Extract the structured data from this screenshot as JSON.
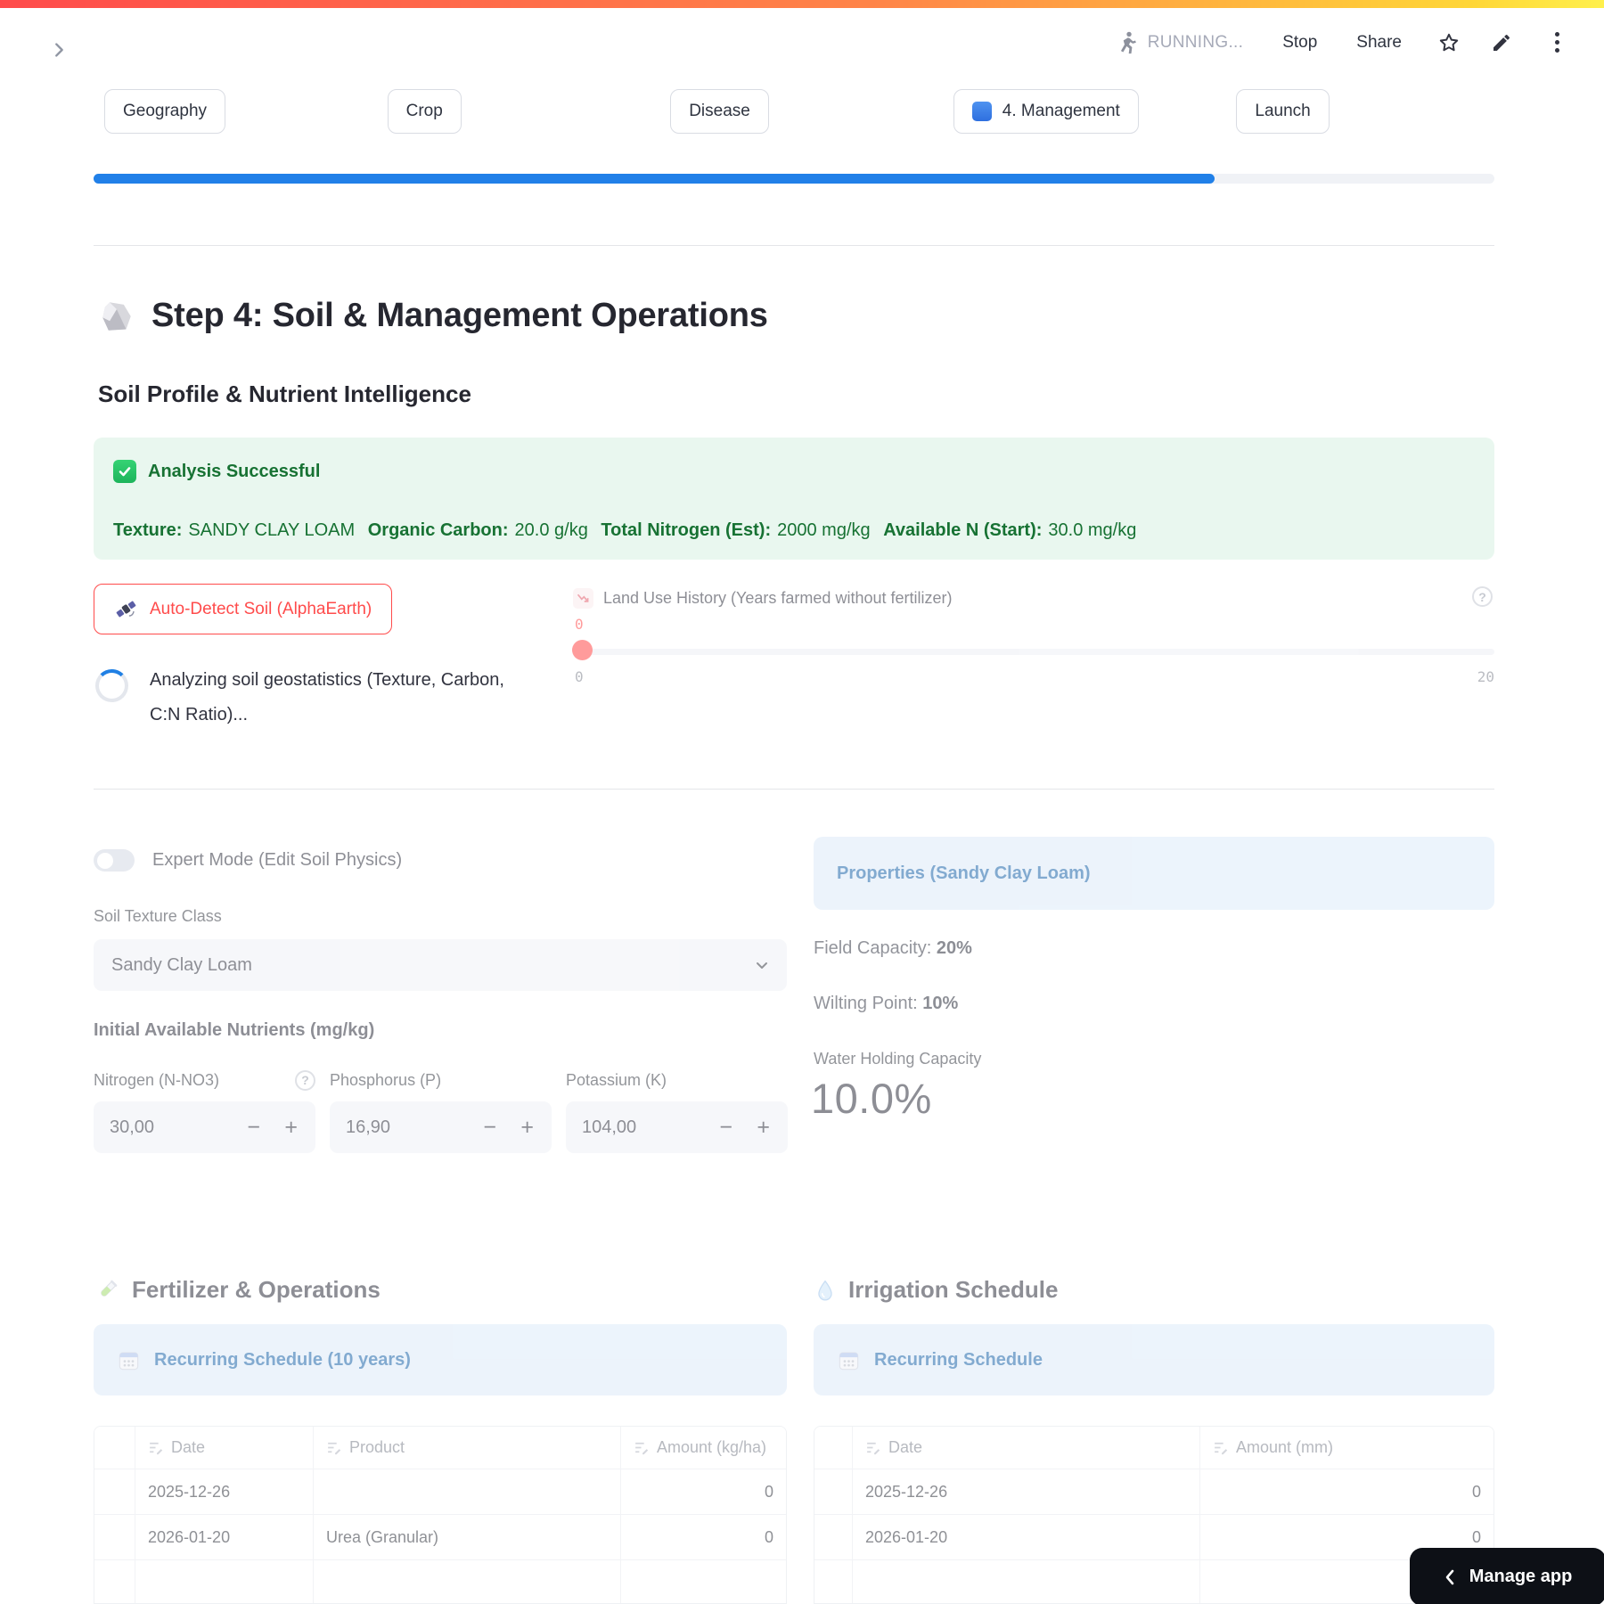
{
  "toolbar": {
    "status": "RUNNING...",
    "stop": "Stop",
    "share": "Share"
  },
  "steps": {
    "geography": "Geography",
    "crop": "Crop",
    "disease": "Disease",
    "management": "4. Management",
    "launch": "Launch"
  },
  "progress_percent": 80,
  "page": {
    "title": "Step 4: Soil & Management Operations",
    "subtitle": "Soil Profile & Nutrient Intelligence"
  },
  "success": {
    "title": "Analysis Successful",
    "texture_label": "Texture:",
    "texture_value": "SANDY CLAY LOAM",
    "oc_label": "Organic Carbon:",
    "oc_value": "20.0 g/kg",
    "tn_label": "Total Nitrogen (Est):",
    "tn_value": "2000 mg/kg",
    "an_label": "Available N (Start):",
    "an_value": "30.0 mg/kg"
  },
  "auto_detect_label": "Auto-Detect Soil (AlphaEarth)",
  "spinner": {
    "line1": "Analyzing soil geostatistics (Texture, Carbon,",
    "line2": "C:N Ratio)..."
  },
  "slider": {
    "label": "Land Use History (Years farmed without fertilizer)",
    "value": "0",
    "min": "0",
    "max": "20"
  },
  "expert_toggle_label": "Expert Mode (Edit Soil Physics)",
  "soil_texture": {
    "label": "Soil Texture Class",
    "value": "Sandy Clay Loam"
  },
  "nutrients": {
    "heading": "Initial Available Nutrients (mg/kg)",
    "items": [
      {
        "label": "Nitrogen (N-NO3)",
        "value": "30,00"
      },
      {
        "label": "Phosphorus (P)",
        "value": "16,90"
      },
      {
        "label": "Potassium (K)",
        "value": "104,00"
      }
    ]
  },
  "properties": {
    "info_title": "Properties (Sandy Clay Loam)",
    "fc_label": "Field Capacity:",
    "fc_value": "20%",
    "wp_label": "Wilting Point:",
    "wp_value": "10%",
    "whc_label": "Water Holding Capacity",
    "whc_value": "10.0%"
  },
  "fertilizer": {
    "heading": "Fertilizer & Operations",
    "schedule_info": "Recurring Schedule (10 years)",
    "table": {
      "columns": [
        "Date",
        "Product",
        "Amount (kg/ha)"
      ],
      "rows": [
        [
          "2025-12-26",
          "",
          "0"
        ],
        [
          "2026-01-20",
          "Urea (Granular)",
          "0"
        ],
        [
          "",
          "",
          ""
        ]
      ]
    }
  },
  "irrigation": {
    "heading": "Irrigation Schedule",
    "schedule_info": "Recurring Schedule",
    "table": {
      "columns": [
        "Date",
        "Amount (mm)"
      ],
      "rows": [
        [
          "2025-12-26",
          "0"
        ],
        [
          "2026-01-20",
          "0"
        ],
        [
          "",
          ""
        ]
      ]
    }
  },
  "manage_app_label": "Manage app",
  "icons": {
    "minus": "−",
    "plus": "+",
    "help": "?"
  },
  "colors": {
    "primary_red": "#ff4b4b",
    "progress_blue": "#2180e8",
    "success_text": "#177233",
    "success_bg": "#e9f7ef",
    "info_text": "#1d66ab",
    "info_bg": "#ddebf9",
    "body_text": "#31333f"
  }
}
